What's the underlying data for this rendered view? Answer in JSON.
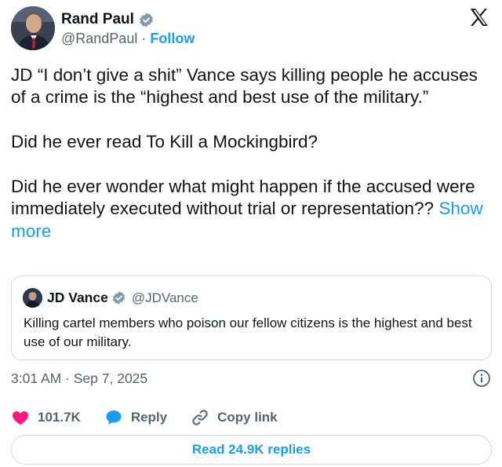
{
  "author": {
    "name": "Rand Paul",
    "handle": "@RandPaul",
    "separator": "·",
    "follow_label": "Follow",
    "avatar_icon": "avatar-photo"
  },
  "tweet": {
    "paragraph1": "JD “I don’t give a shit” Vance says killing people he accuses of a crime is the “highest and best use of the military.”",
    "paragraph2": "Did he ever read To Kill a Mockingbird?",
    "paragraph3": "Did he ever wonder what might happen if the accused were immediately executed without trial or representation??",
    "show_more": "Show more"
  },
  "quote": {
    "name": "JD Vance",
    "handle": "@JDVance",
    "text": "Killing cartel members who poison our fellow citizens is the highest and best use of our military."
  },
  "meta": {
    "timestamp": "3:01 AM · Sep 7, 2025"
  },
  "actions": {
    "likes": "101.7K",
    "reply_label": "Reply",
    "copy_link_label": "Copy link"
  },
  "footer": {
    "read_replies": "Read 24.9K replies"
  },
  "colors": {
    "accent": "#1d9bf0",
    "like": "#f91880",
    "text": "#0f1419",
    "secondary": "#536471",
    "border": "#cfd9de"
  }
}
